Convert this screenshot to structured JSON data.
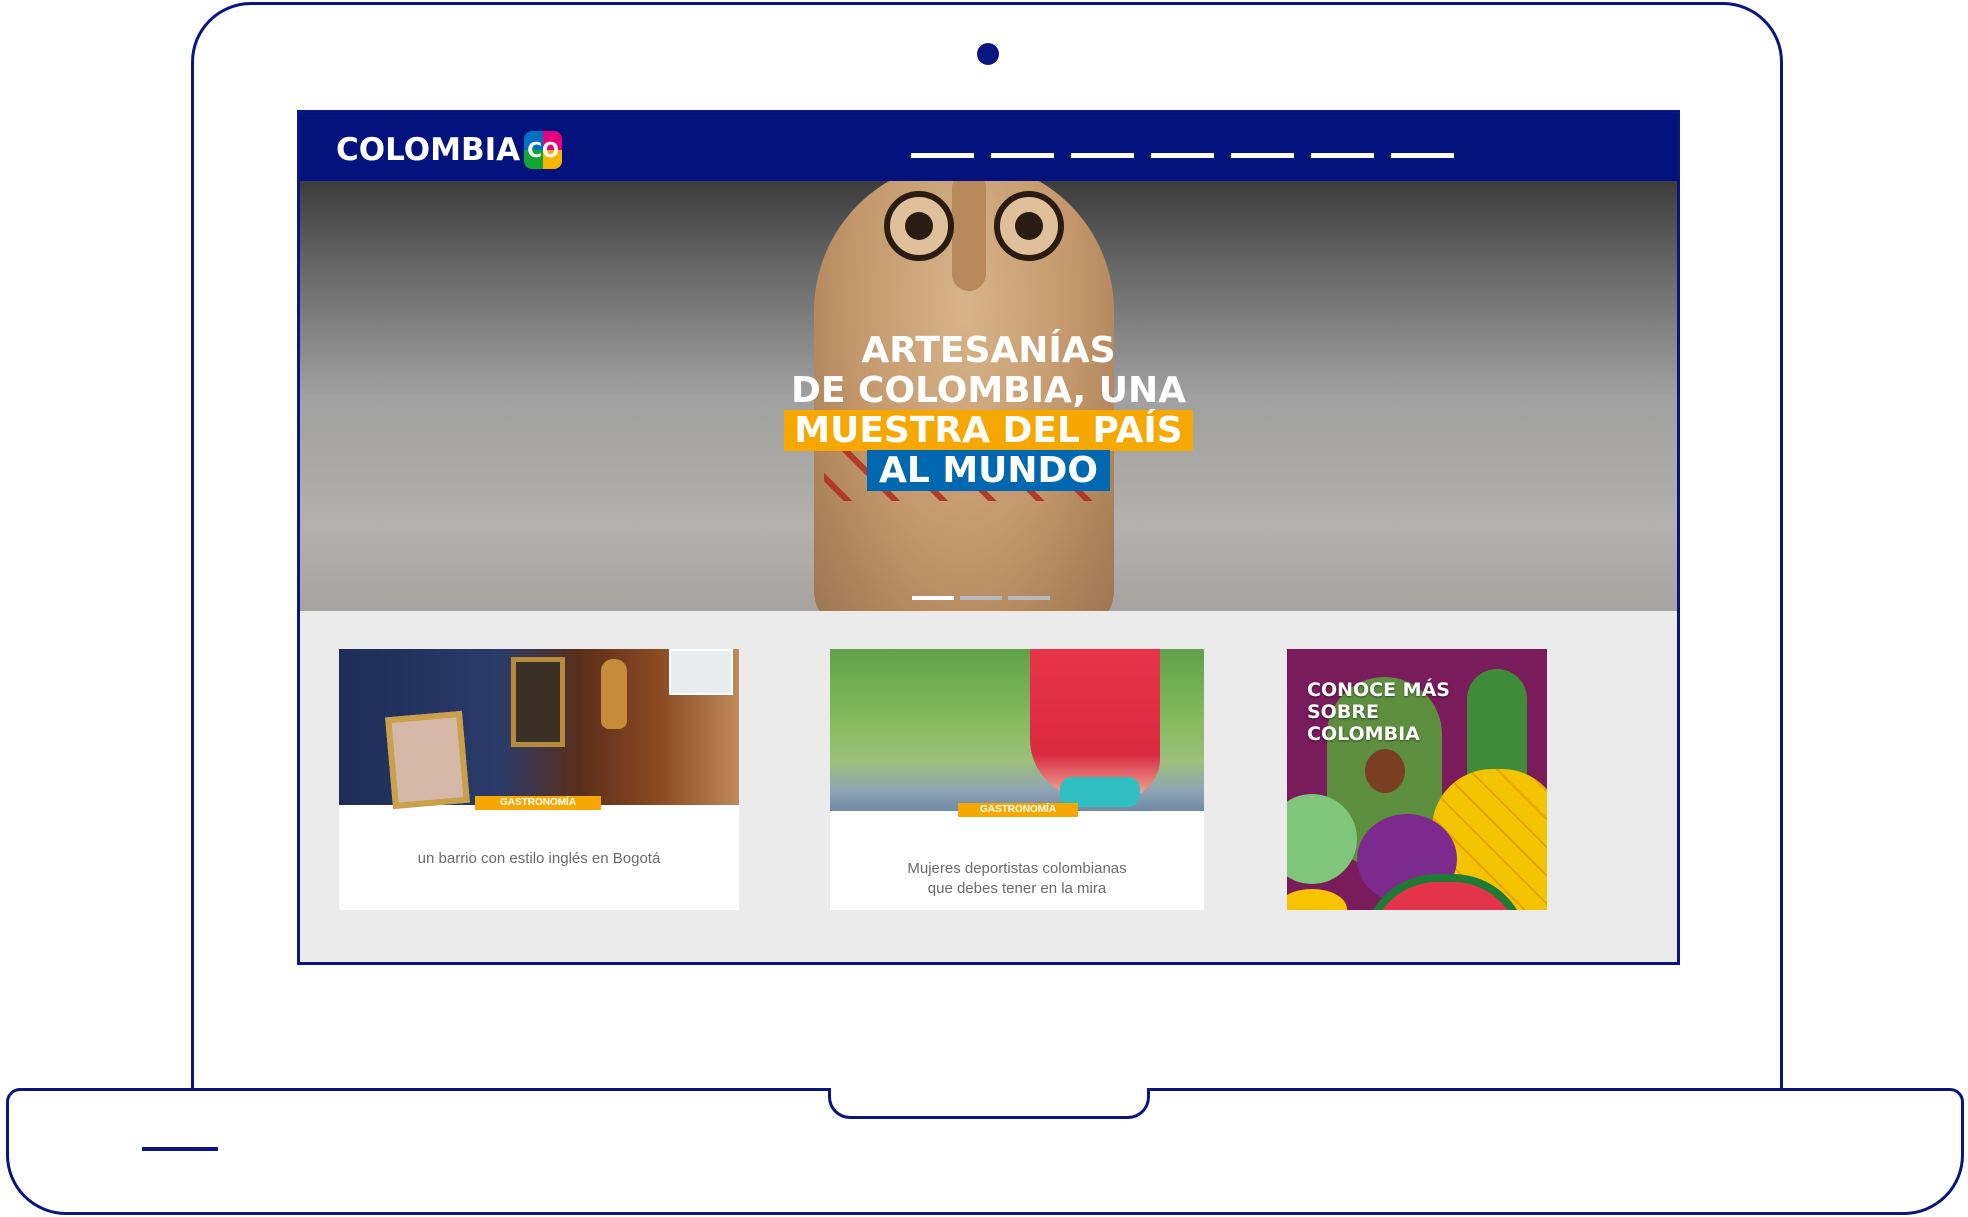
{
  "site": {
    "logo_text": "COLOMBIA",
    "logo_badge": "CO",
    "nav_items": [
      "",
      "",
      "",
      "",
      "",
      "",
      ""
    ]
  },
  "hero": {
    "title_line1": "ARTESANÍAS",
    "title_line2": "DE COLOMBIA, UNA",
    "title_line3": "MUESTRA DEL PAÍS",
    "title_line4": "AL MUNDO",
    "highlight_colors": {
      "yellow": "#f7a800",
      "blue": "#0067b1"
    },
    "carousel": {
      "slides": 3,
      "active": 1
    }
  },
  "cards": [
    {
      "tag": "GASTRONOMÍA",
      "text": "un barrio con estilo inglés en Bogotá"
    },
    {
      "tag": "GASTRONOMÍA",
      "text_line1": "Mujeres deportistas colombianas",
      "text_line2": "que debes tener en la mira"
    }
  ],
  "promo": {
    "line1": "CONOCE MÁS",
    "line2": "SOBRE",
    "line3": "COLOMBIA"
  },
  "colors": {
    "brand_blue": "#03127c",
    "frame": "#0a1580",
    "accent_yellow": "#f7a800"
  }
}
